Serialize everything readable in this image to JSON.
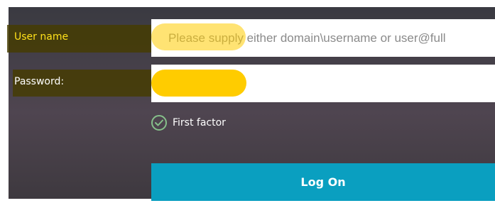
{
  "form": {
    "username_label": "User name",
    "username_placeholder": "Please supply either domain\\username or user@full",
    "password_label": "Password:",
    "factor_text": "First factor",
    "factor_icon": "check-circle-icon",
    "logon_label": "Log On"
  },
  "colors": {
    "panel_bg": "#46404a",
    "highlight": "#ffcc00",
    "logon_button": "#0a9fc0",
    "factor_check": "#86c08a"
  }
}
